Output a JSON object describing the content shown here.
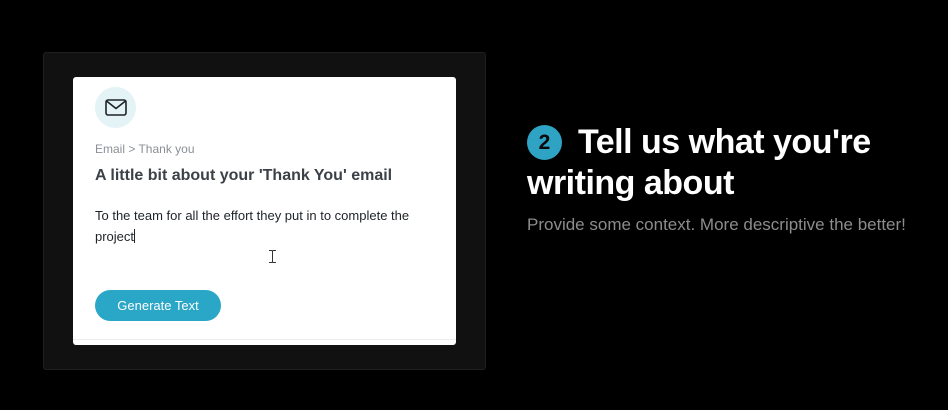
{
  "card": {
    "icon": "envelope-icon",
    "breadcrumb": "Email > Thank you",
    "title": "A little bit about your 'Thank You' email",
    "context_value": "To the team for all the effort they put in to complete the project",
    "generate_label": "Generate Text"
  },
  "step": {
    "number": "2",
    "heading": "Tell us what you're writing about",
    "description": "Provide some context. More descriptive the better!"
  },
  "colors": {
    "accent": "#2aa6c7",
    "step_badge": "#2ea3c4",
    "icon_bg": "#e3f3f6",
    "page_bg": "#000000"
  }
}
